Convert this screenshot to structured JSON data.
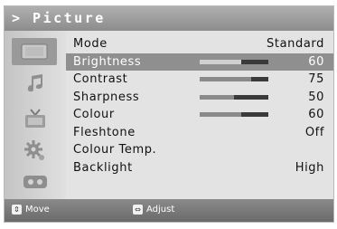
{
  "header": {
    "title": "> Picture"
  },
  "sidebar": {
    "icons": [
      {
        "name": "picture-icon",
        "selected": true
      },
      {
        "name": "sound-icon",
        "selected": false
      },
      {
        "name": "channel-icon",
        "selected": false
      },
      {
        "name": "setup-icon",
        "selected": false
      },
      {
        "name": "input-icon",
        "selected": false
      }
    ]
  },
  "menu": {
    "items": [
      {
        "label": "Mode",
        "value": "Standard",
        "bar": null,
        "selected": false
      },
      {
        "label": "Brightness",
        "value": "60",
        "bar": 0.6,
        "selected": true
      },
      {
        "label": "Contrast",
        "value": "75",
        "bar": 0.75,
        "selected": false
      },
      {
        "label": "Sharpness",
        "value": "50",
        "bar": 0.5,
        "selected": false
      },
      {
        "label": "Colour",
        "value": "60",
        "bar": 0.6,
        "selected": false
      },
      {
        "label": "Fleshtone",
        "value": "Off",
        "bar": null,
        "selected": false
      },
      {
        "label": "Colour Temp.",
        "value": "",
        "bar": null,
        "selected": false
      },
      {
        "label": "Backlight",
        "value": "High",
        "bar": null,
        "selected": false
      }
    ]
  },
  "footer": {
    "move_label": "Move",
    "adjust_label": "Adjust"
  }
}
